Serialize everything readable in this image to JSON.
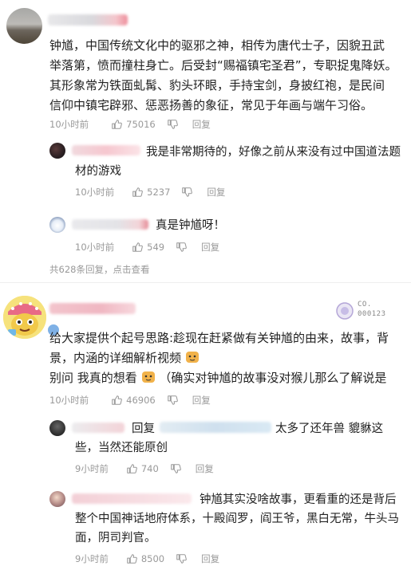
{
  "comment1": {
    "text_line1": "钟馗，中国传统文化中的驱邪之神，相传为唐代士子，因貌丑武",
    "text_line2": "举落第，愤而撞柱身亡。后受封“赐福镇宅圣君”，专职捉鬼降妖。",
    "text_line3": "其形象常为铁面虬髯、豹头环眼，手持宝剑，身披红袍，是民间",
    "text_line4": "信仰中镇宅辟邪、惩恶扬善的象征，常见于年画与端午习俗。",
    "time": "10小时前",
    "likes": "75016",
    "reply_label": "回复",
    "replies": [
      {
        "text_line1": "我是非常期待的，好像之前从来没有过中国道法题",
        "text_line2": "材的游戏",
        "time": "10小时前",
        "likes": "5237",
        "reply_label": "回复"
      },
      {
        "text_line1": "真是钟馗呀！",
        "time": "10小时前",
        "likes": "549",
        "reply_label": "回复"
      }
    ],
    "more_replies": "共628条回复，点击查看"
  },
  "comment2": {
    "badge_text_line1": "CO.",
    "badge_text_line2": "000123",
    "text_line1": "给大家提供个起号思路:趁现在赶紧做有关钟馗的由来，故事，背",
    "text_line2": "景，内涵的详细解析视频",
    "text_line3_a": "别问 我真的想看",
    "text_line3_b": "（确实对钟馗的故事没对猴儿那么了解说是",
    "time": "10小时前",
    "likes": "46906",
    "reply_label": "回复",
    "replies": [
      {
        "prefix": "回复",
        "text_line1_tail": "太多了还年兽 貔貅这",
        "text_line2": "些，当然还能原创",
        "time": "9小时前",
        "likes": "740",
        "reply_label": "回复"
      },
      {
        "text_line1": "钟馗其实没啥故事，更看重的还是背后",
        "text_line2": "整个中国神话地府体系，十殿阎罗，阎王爷，黑白无常，牛头马",
        "text_line3": "面，阴司判官。",
        "time": "9小时前",
        "likes": "8500",
        "reply_label": "回复"
      }
    ]
  }
}
